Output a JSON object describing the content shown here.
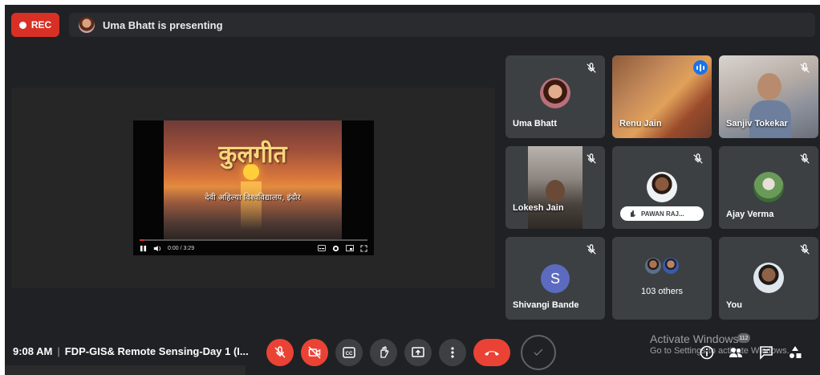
{
  "top": {
    "rec_label": "REC",
    "presenter_text": "Uma Bhatt is presenting"
  },
  "presentation": {
    "video_title": "कुलगीत",
    "video_subtitle": "देवी अहिल्या विश्वविद्यालय, इंदौर",
    "video_time": "0:00 / 3:29",
    "progress": 0.02
  },
  "participants": [
    {
      "name": "Uma Bhatt",
      "muted": true
    },
    {
      "name": "Renu Jain",
      "muted": false,
      "speaking": true
    },
    {
      "name": "Sanjiv Tokekar",
      "muted": true
    },
    {
      "name": "Lokesh Jain",
      "muted": true
    },
    {
      "name": "PAWAN RAJ...",
      "muted": true
    },
    {
      "name": "Ajay Verma",
      "muted": true
    },
    {
      "name": "Shivangi Bande",
      "initial": "S",
      "muted": true
    },
    {
      "name": "103 others"
    },
    {
      "name": "You",
      "muted": true
    }
  ],
  "toolbar": {
    "time": "9:08 AM",
    "meeting_title": "FDP-GIS& Remote Sensing-Day 1 (I...",
    "mic_icon": "mic-off-icon",
    "camera_icon": "camera-off-icon",
    "captions_label": "CC",
    "participant_count": "112"
  },
  "watermark": {
    "line1": "Activate Windows",
    "line2": "Go to Settings to activate Windows."
  },
  "colors": {
    "background": "#202124",
    "tile": "#3c4043",
    "red": "#ea4335",
    "accent": "#1a73e8"
  }
}
